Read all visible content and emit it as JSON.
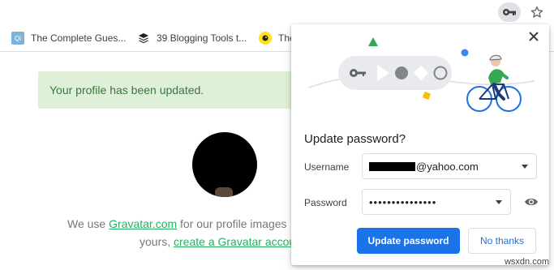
{
  "toolbar": {
    "key_icon": "key-icon",
    "star_icon": "star-icon"
  },
  "bookmarks": [
    {
      "label": "The Complete Gues...",
      "icon": "qi-favicon"
    },
    {
      "label": "39 Blogging Tools t...",
      "icon": "buffer-favicon"
    },
    {
      "label": "The",
      "icon": "mailchimp-favicon"
    }
  ],
  "page": {
    "alert": "Your profile has been updated.",
    "gravatar_prefix": "We use ",
    "gravatar_link": "Gravatar.com",
    "gravatar_suffix": " for our profile images",
    "yours_prefix": "yours, ",
    "create_link": "create a Gravatar accou"
  },
  "dialog": {
    "title": "Update password?",
    "username_label": "Username",
    "username_value": "@yahoo.com",
    "password_label": "Password",
    "password_value": "•••••••••••••••",
    "update_button": "Update password",
    "no_thanks_button": "No thanks",
    "colors": {
      "primary": "#1a73e8",
      "green": "#34a853",
      "yellow": "#fbbc04",
      "blue": "#4285f4"
    }
  },
  "watermark": "wsxdn.com"
}
